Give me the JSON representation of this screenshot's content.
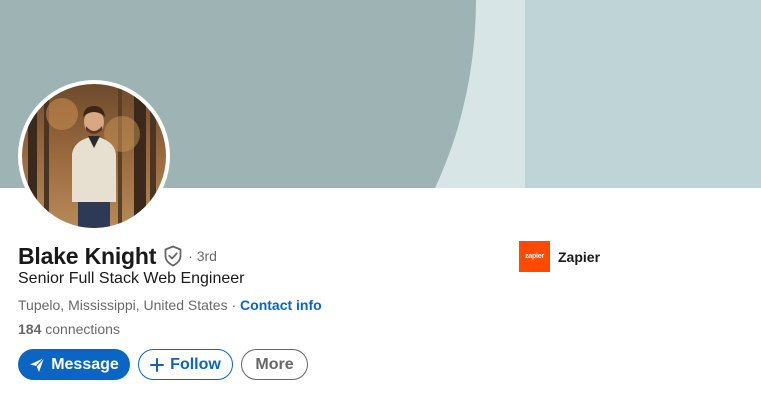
{
  "profile": {
    "name": "Blake Knight",
    "degree": "· 3rd",
    "headline": "Senior Full Stack Web Engineer",
    "location": "Tupelo, Mississippi, United States",
    "separator": " · ",
    "contact_info": "Contact info",
    "connections_count": "184",
    "connections_label": "connections"
  },
  "company": {
    "name": "Zapier",
    "logo_text": "zapier",
    "logo_color": "#ff4a00"
  },
  "actions": {
    "message": "Message",
    "follow": "Follow",
    "more": "More"
  },
  "icons": {
    "verified": "shield-check-icon",
    "message": "paper-plane-icon",
    "follow": "plus-icon"
  },
  "colors": {
    "primary": "#0a66c2",
    "banner_dark": "#9db3b4",
    "banner_light": "#bed4d6"
  }
}
